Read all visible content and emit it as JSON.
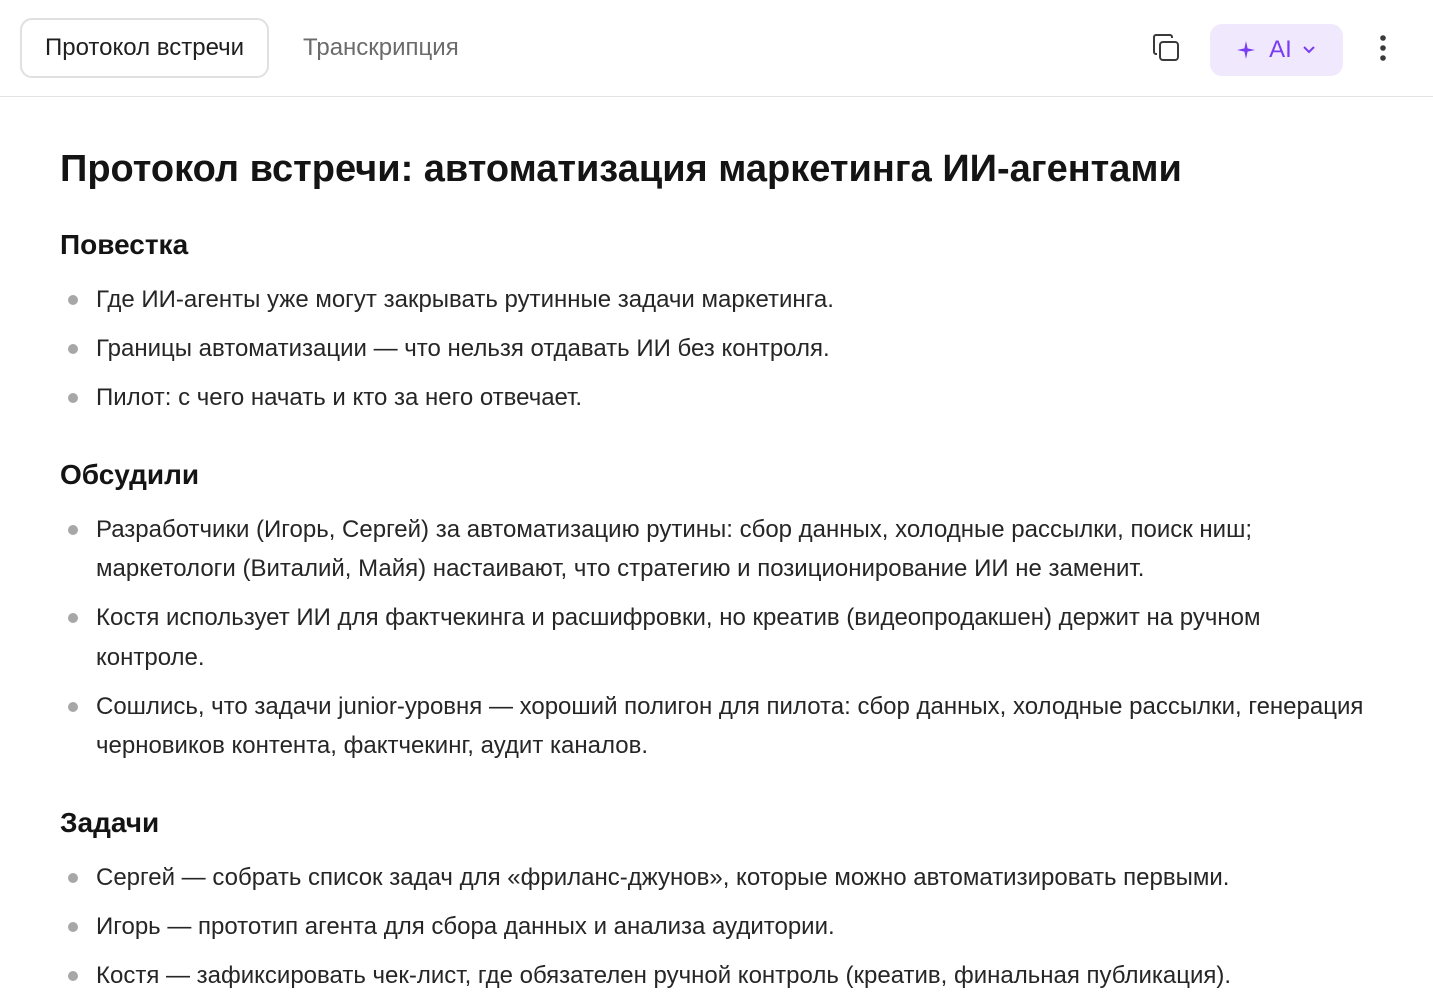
{
  "tabs": {
    "protocol": "Протокол встречи",
    "transcription": "Транскрипция"
  },
  "toolbar": {
    "ai_label": "AI",
    "copy_icon": "copy-icon",
    "sparkle_icon": "sparkle-icon",
    "chevron_icon": "chevron-down-icon",
    "more_icon": "more-vertical-icon"
  },
  "colors": {
    "accent": "#7a3cf0",
    "accent_bg": "#f0e9fd"
  },
  "document": {
    "title": "Протокол встречи: автоматизация маркетинга ИИ-агентами",
    "sections": [
      {
        "heading": "Повестка",
        "items": [
          "Где ИИ-агенты уже могут закрывать рутинные задачи маркетинга.",
          "Границы автоматизации — что нельзя отдавать ИИ без контроля.",
          "Пилот: с чего начать и кто за него отвечает."
        ]
      },
      {
        "heading": "Обсудили",
        "items": [
          "Разработчики (Игорь, Сергей) за автоматизацию рутины: сбор данных, холодные рассылки, поиск ниш; маркетологи (Виталий, Майя) настаивают, что стратегию и позиционирование ИИ не заменит.",
          "Костя использует ИИ для фактчекинга и расшифровки, но креатив (видеопродакшен) держит на ручном контроле.",
          "Сошлись, что задачи junior-уровня — хороший полигон для пилота: сбор данных, холодные рассылки, генерация черновиков контента, фактчекинг, аудит каналов."
        ]
      },
      {
        "heading": "Задачи",
        "items": [
          "Сергей — собрать список задач для «фриланс-джунов», которые можно автоматизировать первыми.",
          "Игорь — прототип агента для сбора данных и анализа аудитории.",
          "Костя — зафиксировать чек-лист, где обязателен ручной контроль (креатив, финальная публикация)."
        ]
      }
    ]
  }
}
